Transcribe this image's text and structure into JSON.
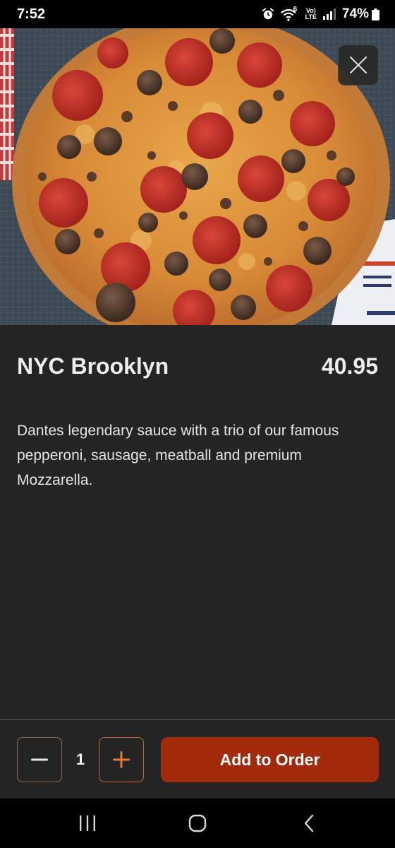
{
  "status_bar": {
    "time": "7:52",
    "wifi_badge": "6",
    "volte_top": "Vo)",
    "volte_bottom": "LTE",
    "battery": "74%",
    "icons": [
      "alarm-icon",
      "wifi-icon",
      "volte-icon",
      "signal-icon",
      "battery-icon"
    ]
  },
  "hero": {
    "image": "pepperoni-sausage-meatball-pizza",
    "close_icon": "close-icon"
  },
  "item": {
    "name": "NYC Brooklyn",
    "price": "40.95",
    "description": "Dantes legendary sauce with a trio of our famous pepperoni, sausage, meatball and premium Mozzarella."
  },
  "order": {
    "quantity": "1",
    "minus_icon": "minus-icon",
    "plus_icon": "plus-icon",
    "add_label": "Add to Order"
  },
  "nav": {
    "icons": [
      "recent-apps-icon",
      "home-icon",
      "back-icon"
    ]
  },
  "colors": {
    "background": "#242424",
    "accent": "#a32a0b",
    "plus_border": "#d1662e",
    "status_bar": "#000000"
  }
}
